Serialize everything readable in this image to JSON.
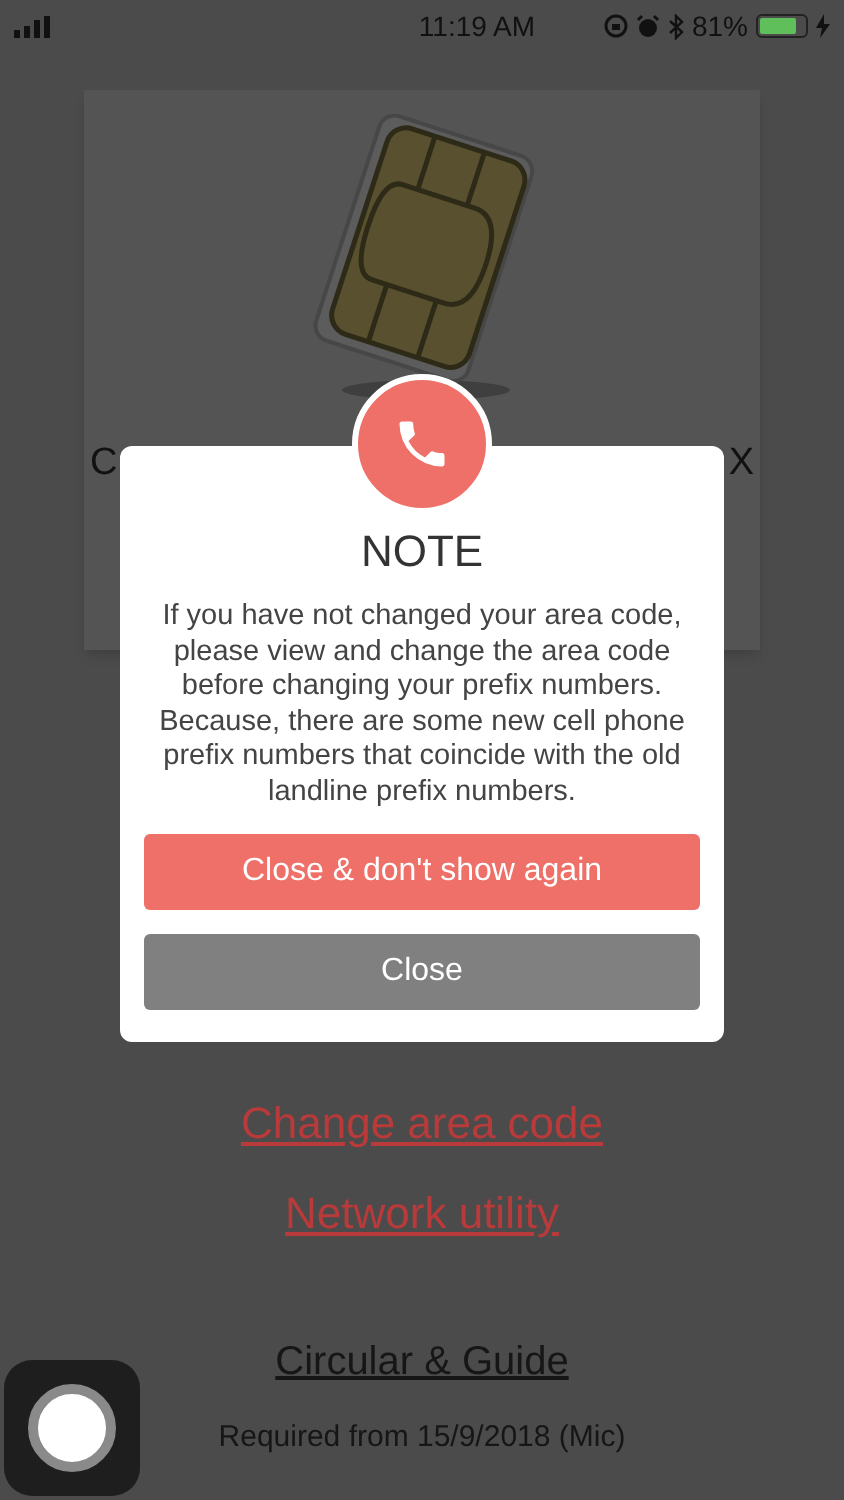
{
  "status_bar": {
    "time": "11:19 AM",
    "battery_percent": "81%",
    "battery": {
      "level": 0.81,
      "charging": true
    }
  },
  "card": {
    "title_start": "C",
    "title_end": "X"
  },
  "links": [
    {
      "label": "Change area code"
    },
    {
      "label": "Network utility"
    }
  ],
  "guide": {
    "label": "Circular & Guide",
    "note": "Required from 15/9/2018 (Mic)"
  },
  "dialog": {
    "title": "NOTE",
    "message": "If you have not changed your area code, please view and change the area code before changing your prefix numbers. Because, there are some new cell phone prefix numbers that coincide with the old landline prefix numbers.",
    "buttons": [
      {
        "label": "Close & don't show again",
        "kind": "primary"
      },
      {
        "label": "Close",
        "kind": "secondary"
      }
    ]
  }
}
